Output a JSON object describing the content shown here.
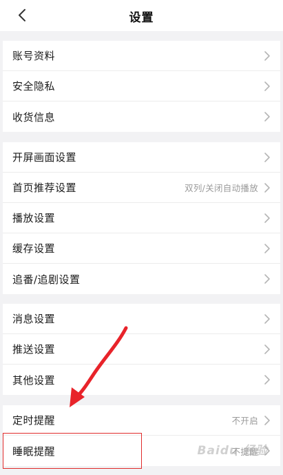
{
  "header": {
    "title": "设置"
  },
  "groups": [
    {
      "items": [
        {
          "label": "账号资料",
          "value": ""
        },
        {
          "label": "安全隐私",
          "value": ""
        },
        {
          "label": "收货信息",
          "value": ""
        }
      ]
    },
    {
      "items": [
        {
          "label": "开屏画面设置",
          "value": ""
        },
        {
          "label": "首页推荐设置",
          "value": "双列/关闭自动播放"
        },
        {
          "label": "播放设置",
          "value": ""
        },
        {
          "label": "缓存设置",
          "value": ""
        },
        {
          "label": "追番/追剧设置",
          "value": ""
        }
      ]
    },
    {
      "items": [
        {
          "label": "消息设置",
          "value": ""
        },
        {
          "label": "推送设置",
          "value": ""
        },
        {
          "label": "其他设置",
          "value": ""
        }
      ]
    },
    {
      "items": [
        {
          "label": "定时提醒",
          "value": "不开启"
        },
        {
          "label": "睡眠提醒",
          "value": "不提醒"
        }
      ]
    }
  ],
  "annotation": {
    "arrow_color": "#e8232a",
    "box_color": "#e02a2a"
  },
  "watermark": {
    "text": "Baidu 经验"
  },
  "icons": {
    "back": "chevron-left-icon",
    "row": "chevron-right-icon"
  }
}
